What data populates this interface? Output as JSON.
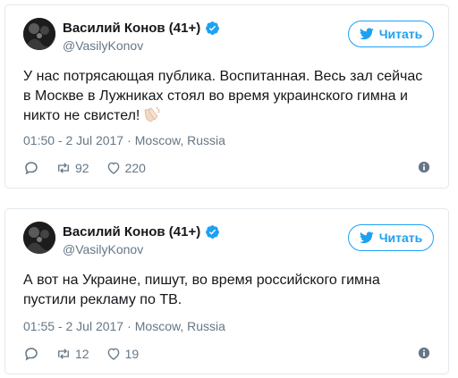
{
  "tweets": [
    {
      "display_name": "Василий Конов (41+)",
      "handle": "@VasilyKonov",
      "follow_label": "Читать",
      "text": "У нас потрясающая публика. Воспитанная. Весь зал сейчас в Москве в Лужниках стоял во время украинского гимна и никто не свистел!",
      "emoji": "clapping-hands-emoji",
      "time": "01:50 - 2 Jul 2017",
      "separator": "·",
      "location": "Moscow, Russia",
      "retweets": "92",
      "likes": "220"
    },
    {
      "display_name": "Василий Конов (41+)",
      "handle": "@VasilyKonov",
      "follow_label": "Читать",
      "text": "А вот на Украине, пишут, во время российского гимна пустили рекламу по ТВ.",
      "time": "01:55 - 2 Jul 2017",
      "separator": "·",
      "location": "Moscow, Russia",
      "retweets": "12",
      "likes": "19"
    }
  ],
  "colors": {
    "accent": "#1da1f2",
    "text": "#14171a",
    "secondary": "#657786",
    "border": "#e1e8ed"
  }
}
